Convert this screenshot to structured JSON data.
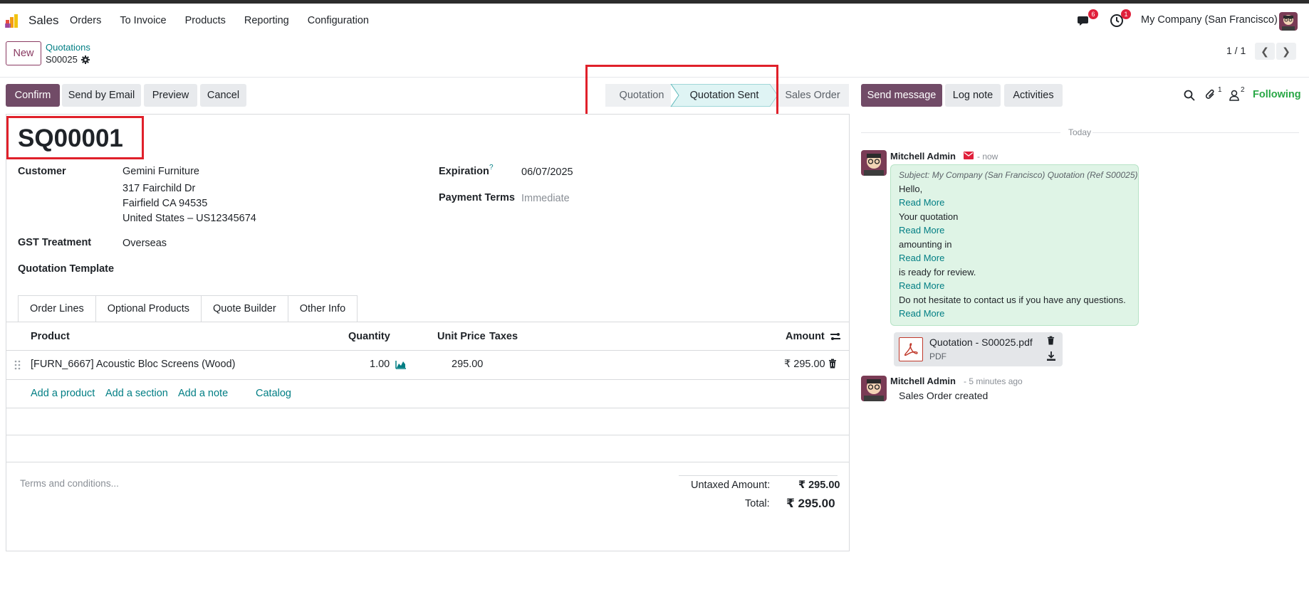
{
  "navbar": {
    "app_name": "Sales",
    "menu": [
      "Orders",
      "To Invoice",
      "Products",
      "Reporting",
      "Configuration"
    ],
    "messages_count": "6",
    "activities_count": "1",
    "company": "My Company (San Francisco)"
  },
  "control": {
    "new_label": "New",
    "breadcrumb_parent": "Quotations",
    "breadcrumb_current": "S00025",
    "pager": "1 / 1"
  },
  "status": {
    "confirm": "Confirm",
    "send_email": "Send by Email",
    "preview": "Preview",
    "cancel": "Cancel",
    "stages": [
      "Quotation",
      "Quotation Sent",
      "Sales Order"
    ],
    "active_stage": "Quotation Sent"
  },
  "form": {
    "name": "SQ00001",
    "customer_label": "Customer",
    "customer_lines": [
      "Gemini Furniture",
      "317 Fairchild Dr",
      "Fairfield CA 94535",
      "United States – US12345674"
    ],
    "gst_label": "GST Treatment",
    "gst_value": "Overseas",
    "template_label": "Quotation Template",
    "expiration_label": "Expiration",
    "expiration_help": "?",
    "expiration_value": "06/07/2025",
    "payment_terms_label": "Payment Terms",
    "payment_terms_value": "Immediate",
    "tabs": [
      "Order Lines",
      "Optional Products",
      "Quote Builder",
      "Other Info"
    ],
    "columns": {
      "product": "Product",
      "quantity": "Quantity",
      "unit_price": "Unit Price",
      "taxes": "Taxes",
      "amount": "Amount"
    },
    "lines": [
      {
        "product": "[FURN_6667] Acoustic Bloc Screens (Wood)",
        "quantity": "1.00",
        "unit_price": "295.00",
        "taxes": "",
        "amount": "₹ 295.00"
      }
    ],
    "actions": {
      "add_product": "Add a product",
      "add_section": "Add a section",
      "add_note": "Add a note",
      "catalog": "Catalog"
    },
    "terms_placeholder": "Terms and conditions...",
    "untaxed_label": "Untaxed Amount:",
    "untaxed_value": "₹ 295.00",
    "total_label": "Total:",
    "total_value": "₹ 295.00"
  },
  "chatter": {
    "send_message": "Send message",
    "log_note": "Log note",
    "activities": "Activities",
    "attachments_count": "1",
    "followers_count": "2",
    "following": "Following",
    "date_separator": "Today",
    "messages": [
      {
        "author": "Mitchell Admin",
        "time": "- now",
        "subject": "Subject: My Company (San Francisco) Quotation (Ref S00025)",
        "body": [
          "Hello,",
          "Read More",
          "Your quotation",
          "Read More",
          "amounting in",
          "Read More",
          "is ready for review.",
          "Read More",
          "Do not hesitate to contact us if you have any questions.",
          "Read More"
        ],
        "attachment": {
          "name": "Quotation - S00025.pdf",
          "type": "PDF"
        }
      },
      {
        "author": "Mitchell Admin",
        "time": "- 5 minutes ago",
        "body_text": "Sales Order created"
      }
    ]
  },
  "colors": {
    "brand": "#714b67",
    "link": "#017e84",
    "highlight_box": "#e0202a",
    "active_stage": "#dff4f4"
  }
}
